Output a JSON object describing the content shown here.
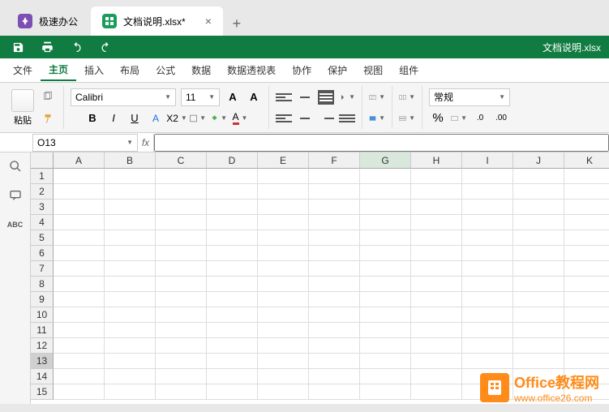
{
  "tabs": {
    "app_name": "极速办公",
    "doc_name": "文档说明.xlsx*"
  },
  "quickbar": {
    "title": "文档说明.xlsx"
  },
  "menu": {
    "file": "文件",
    "home": "主页",
    "insert": "插入",
    "layout": "布局",
    "formula": "公式",
    "data": "数据",
    "pivot": "数据透视表",
    "collab": "协作",
    "protect": "保护",
    "view": "视图",
    "components": "组件"
  },
  "ribbon": {
    "paste": "粘贴",
    "font_name": "Calibri",
    "font_size": "11",
    "number_format": "常规",
    "percent": "%",
    "bold": "B",
    "italic": "I",
    "underline": "U",
    "bigA": "A",
    "smallA": "A",
    "letterA": "A",
    "x2": "X"
  },
  "namebox": {
    "value": "O13",
    "fx": "fx"
  },
  "columns": [
    "A",
    "B",
    "C",
    "D",
    "E",
    "F",
    "G",
    "H",
    "I",
    "J",
    "K"
  ],
  "rows": [
    "1",
    "2",
    "3",
    "4",
    "5",
    "6",
    "7",
    "8",
    "9",
    "10",
    "11",
    "12",
    "13",
    "14",
    "15"
  ],
  "selected_col_index": 6,
  "selected_row_index": 12,
  "sidebar": {
    "abc": "ABC"
  },
  "watermark": {
    "title": "Office教程网",
    "url": "www.office26.com"
  },
  "chart_data": null
}
